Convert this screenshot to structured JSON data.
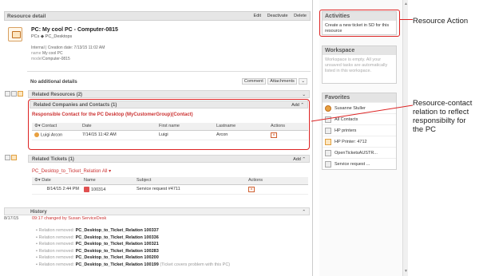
{
  "resource_detail": {
    "title": "Resource detail",
    "actions": [
      "Edit",
      "Deactivate",
      "Delete"
    ]
  },
  "pc": {
    "title": "PC: My cool PC - Computer-0815",
    "tags": "PCs  ◆ PC_Desktops",
    "creation": "Internal | Creation date: 7/13/15 11:02 AM",
    "name_label": "name",
    "name_value": "My cool PC",
    "model_label": "model",
    "model_value": "Computer-0815"
  },
  "no_additional": {
    "label": "No additional details",
    "comment": "Comment",
    "attachments": "Attachments"
  },
  "related_resources": {
    "label": "Related Resources (2)"
  },
  "related_companies": {
    "label": "Related Companies and Contacts (1)",
    "add": "Add",
    "link": "Responsible Contact for the PC Desktop (MyCustomerGroup)(Contact)",
    "columns": [
      "Contact",
      "Date",
      "First name",
      "Lastname",
      "Actions"
    ],
    "rows": [
      {
        "contact": "Luigi Arcon",
        "date": "7/14/15 11:42 AM",
        "first": "Luigi",
        "last": "Arcon"
      }
    ]
  },
  "related_tickets": {
    "label": "Related Tickets (1)",
    "add": "Add",
    "relation": "PC_Desktop_to_Ticket_Relation All",
    "columns": [
      "Date",
      "Name",
      "Subject",
      "Actions"
    ],
    "rows": [
      {
        "date": "8/14/15 2:44 PM",
        "name": "100314",
        "subject": "Service request #4711"
      }
    ]
  },
  "history": {
    "label": "History",
    "date": "8/17/15",
    "change": "09:17 changed by Susan ServiceDesk",
    "removed_word": "Relation removed:",
    "items": [
      {
        "name": "PC_Desktop_to_Ticket_Relation 100337",
        "note": ""
      },
      {
        "name": "PC_Desktop_to_Ticket_Relation 100336",
        "note": ""
      },
      {
        "name": "PC_Desktop_to_Ticket_Relation 100321",
        "note": ""
      },
      {
        "name": "PC_Desktop_to_Ticket_Relation 100283",
        "note": ""
      },
      {
        "name": "PC_Desktop_to_Ticket_Relation 100200",
        "note": ""
      },
      {
        "name": "PC_Desktop_to_Ticket_Relation 100199",
        "note": "(Ticket covers problem with this PC)"
      }
    ]
  },
  "sidebar": {
    "activities": {
      "title": "Activities",
      "text": "Create a new ticket in SD for this resource"
    },
    "workspace": {
      "title": "Workspace",
      "text": "Workspace is empty. All your unsaved tasks are automatically listed in this workspace."
    },
    "favorites": {
      "title": "Favorites",
      "items": [
        "Susanne Stuller",
        "All Contacts",
        "HP printers",
        "HP Printer: 4712",
        "OpenTicketsAUSTR...",
        "Service request ..."
      ]
    }
  },
  "annotations": {
    "resource_action": "Resource Action",
    "contact_relation": "Resource-contact relation to reflect responsibilty for the PC"
  },
  "colors": {
    "highlight": "#dd2222",
    "link": "#cc3333"
  }
}
